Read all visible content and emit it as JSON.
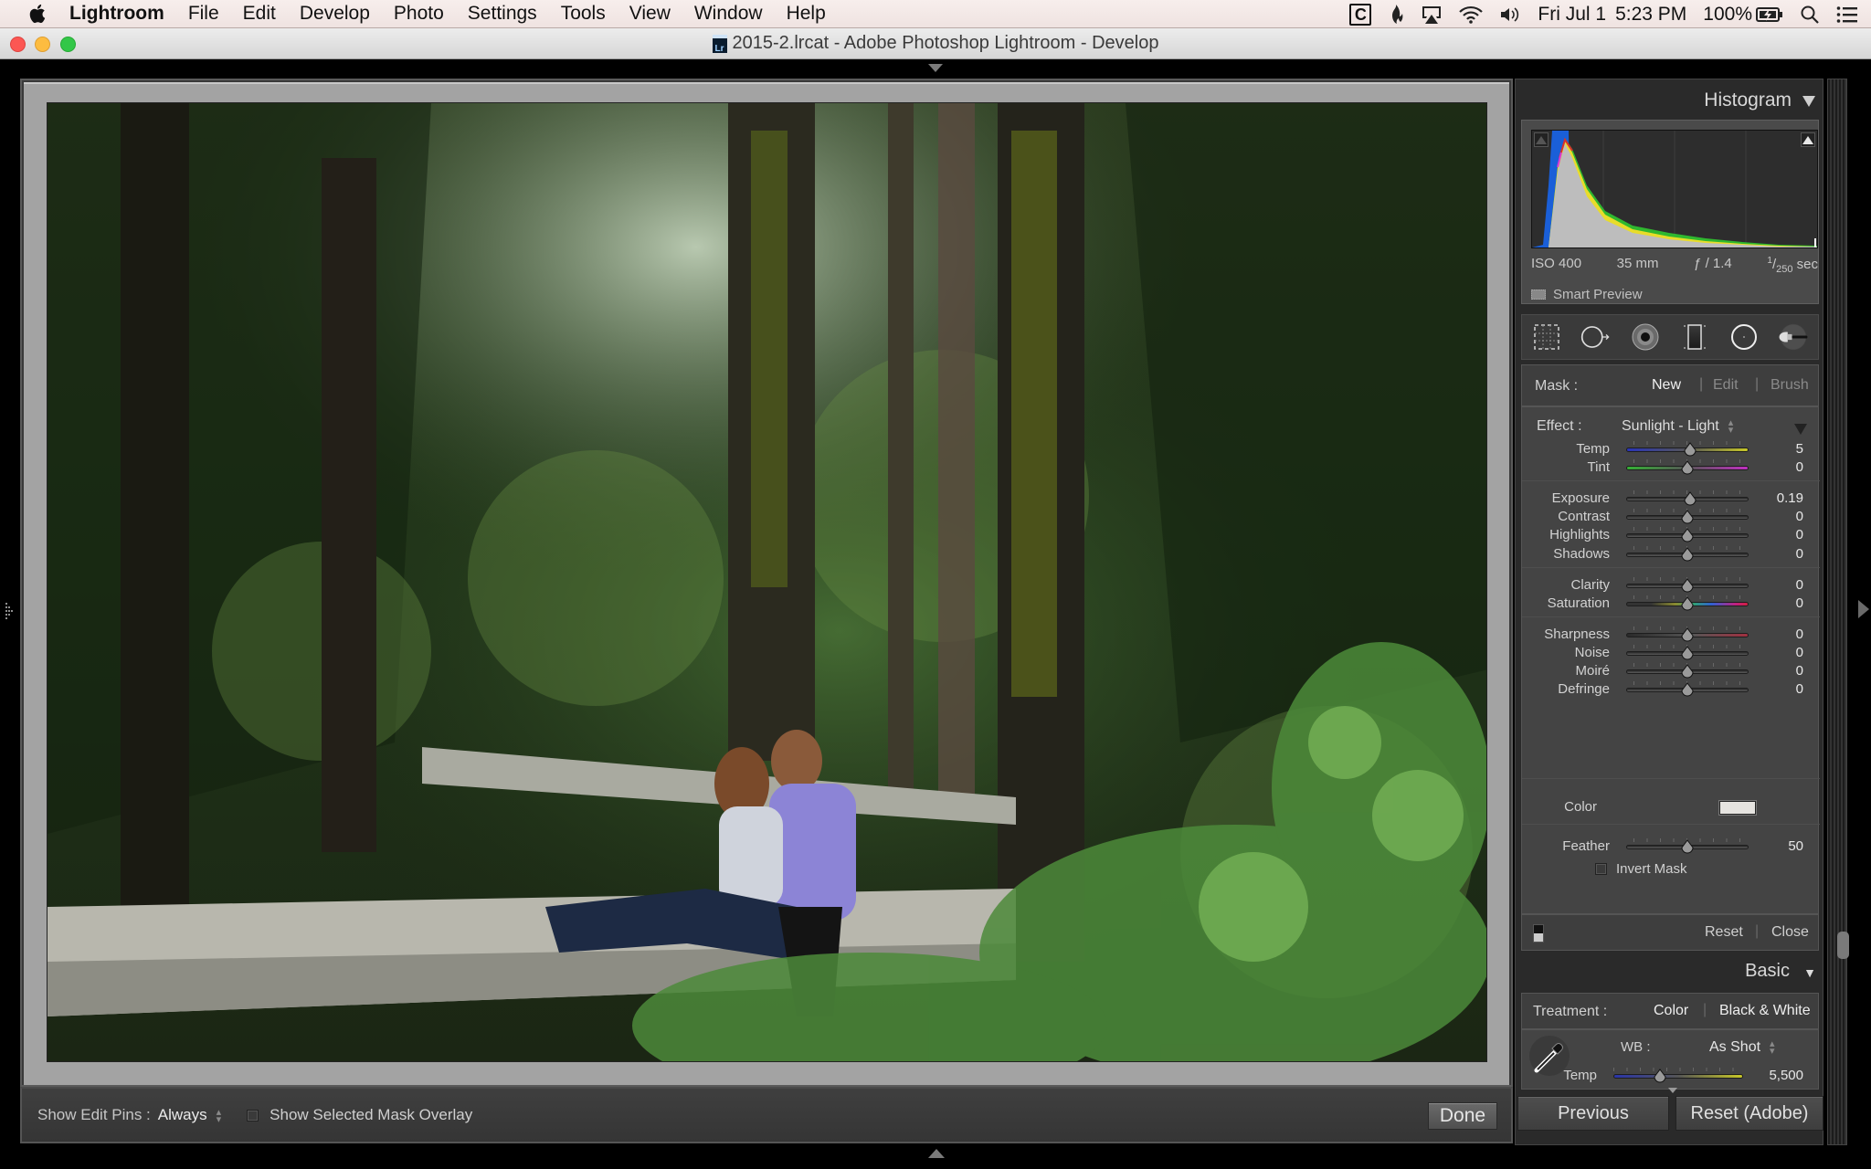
{
  "menubar": {
    "app_name": "Lightroom",
    "items": [
      "File",
      "Edit",
      "Develop",
      "Photo",
      "Settings",
      "Tools",
      "View",
      "Window",
      "Help"
    ],
    "status": {
      "date": "Fri Jul 1",
      "time": "5:23 PM",
      "battery": "100%"
    }
  },
  "window": {
    "title": "2015-2.lrcat - Adobe Photoshop Lightroom - Develop"
  },
  "toolbar": {
    "edit_pins_label": "Show Edit Pins :",
    "edit_pins_value": "Always",
    "mask_overlay_label": "Show Selected Mask Overlay",
    "mask_overlay_checked": false,
    "done_label": "Done"
  },
  "histogram": {
    "title": "Histogram",
    "iso": "ISO 400",
    "focal_length": "35 mm",
    "aperture": "ƒ / 1.4",
    "shutter_num": "1",
    "shutter_den": "250",
    "shutter_unit": "sec",
    "smart_preview": "Smart Preview"
  },
  "tools": [
    "crop-overlay",
    "spot-removal",
    "red-eye-correction",
    "graduated-filter",
    "radial-filter",
    "adjustment-brush"
  ],
  "mask": {
    "label": "Mask :",
    "new": "New",
    "edit": "Edit",
    "brush": "Brush"
  },
  "effect": {
    "label": "Effect :",
    "preset": "Sunlight - Light",
    "sliders": [
      {
        "name": "Temp",
        "value": "5",
        "pos": 0.52,
        "track": "temp"
      },
      {
        "name": "Tint",
        "value": "0",
        "pos": 0.5,
        "track": "tint"
      },
      {
        "name": "Exposure",
        "value": "0.19",
        "pos": 0.52,
        "track": "gray"
      },
      {
        "name": "Contrast",
        "value": "0",
        "pos": 0.5,
        "track": "gray"
      },
      {
        "name": "Highlights",
        "value": "0",
        "pos": 0.5,
        "track": "gray"
      },
      {
        "name": "Shadows",
        "value": "0",
        "pos": 0.5,
        "track": "gray"
      },
      {
        "name": "Clarity",
        "value": "0",
        "pos": 0.5,
        "track": "gray"
      },
      {
        "name": "Saturation",
        "value": "0",
        "pos": 0.5,
        "track": "sat"
      },
      {
        "name": "Sharpness",
        "value": "0",
        "pos": 0.5,
        "track": "sharp"
      },
      {
        "name": "Noise",
        "value": "0",
        "pos": 0.5,
        "track": "gray"
      },
      {
        "name": "Moiré",
        "value": "0",
        "pos": 0.5,
        "track": "gray"
      },
      {
        "name": "Defringe",
        "value": "0",
        "pos": 0.5,
        "track": "gray"
      }
    ],
    "color_label": "Color",
    "color_swatch": "#e6e4e0",
    "feather_label": "Feather",
    "feather_value": "50",
    "feather_pos": 0.5,
    "invert_mask_label": "Invert Mask",
    "invert_mask_checked": false,
    "reset_label": "Reset",
    "close_label": "Close"
  },
  "basic": {
    "title": "Basic",
    "treatment_label": "Treatment :",
    "treatment_color": "Color",
    "treatment_bw": "Black & White",
    "wb_label": "WB :",
    "wb_value": "As Shot",
    "temp_label": "Temp",
    "temp_value": "5,500",
    "temp_pos": 0.36
  },
  "footer_buttons": {
    "previous": "Previous",
    "reset": "Reset (Adobe)"
  }
}
